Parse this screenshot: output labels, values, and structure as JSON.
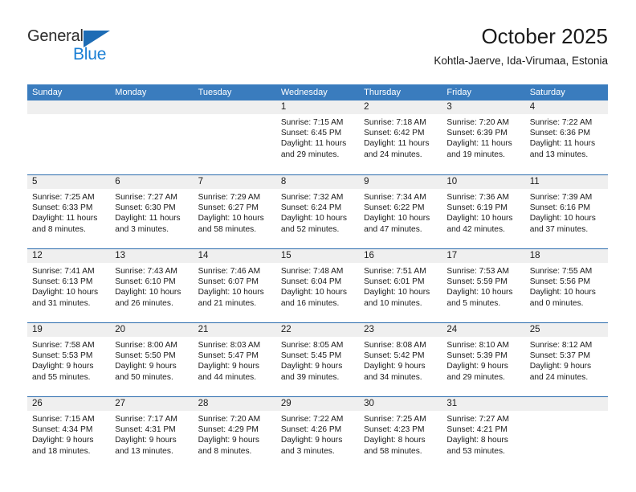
{
  "brand": {
    "name_part1": "General",
    "name_part2": "Blue",
    "triangle_icon": "triangle-logo-icon",
    "accent_color": "#1b7fd4",
    "triangle_color": "#1d6cb5"
  },
  "header": {
    "title": "October 2025",
    "subtitle": "Kohtla-Jaerve, Ida-Virumaa, Estonia"
  },
  "calendar": {
    "header_bg": "#3a7cbe",
    "row_divider_color": "#2b6cad",
    "daynum_bg": "#efefef",
    "weekdays": [
      "Sunday",
      "Monday",
      "Tuesday",
      "Wednesday",
      "Thursday",
      "Friday",
      "Saturday"
    ],
    "weeks": [
      [
        {
          "day": "",
          "empty": true,
          "sunrise": "",
          "sunset": "",
          "daylight1": "",
          "daylight2": ""
        },
        {
          "day": "",
          "empty": true,
          "sunrise": "",
          "sunset": "",
          "daylight1": "",
          "daylight2": ""
        },
        {
          "day": "",
          "empty": true,
          "sunrise": "",
          "sunset": "",
          "daylight1": "",
          "daylight2": ""
        },
        {
          "day": "1",
          "empty": false,
          "sunrise": "Sunrise: 7:15 AM",
          "sunset": "Sunset: 6:45 PM",
          "daylight1": "Daylight: 11 hours",
          "daylight2": "and 29 minutes."
        },
        {
          "day": "2",
          "empty": false,
          "sunrise": "Sunrise: 7:18 AM",
          "sunset": "Sunset: 6:42 PM",
          "daylight1": "Daylight: 11 hours",
          "daylight2": "and 24 minutes."
        },
        {
          "day": "3",
          "empty": false,
          "sunrise": "Sunrise: 7:20 AM",
          "sunset": "Sunset: 6:39 PM",
          "daylight1": "Daylight: 11 hours",
          "daylight2": "and 19 minutes."
        },
        {
          "day": "4",
          "empty": false,
          "sunrise": "Sunrise: 7:22 AM",
          "sunset": "Sunset: 6:36 PM",
          "daylight1": "Daylight: 11 hours",
          "daylight2": "and 13 minutes."
        }
      ],
      [
        {
          "day": "5",
          "empty": false,
          "sunrise": "Sunrise: 7:25 AM",
          "sunset": "Sunset: 6:33 PM",
          "daylight1": "Daylight: 11 hours",
          "daylight2": "and 8 minutes."
        },
        {
          "day": "6",
          "empty": false,
          "sunrise": "Sunrise: 7:27 AM",
          "sunset": "Sunset: 6:30 PM",
          "daylight1": "Daylight: 11 hours",
          "daylight2": "and 3 minutes."
        },
        {
          "day": "7",
          "empty": false,
          "sunrise": "Sunrise: 7:29 AM",
          "sunset": "Sunset: 6:27 PM",
          "daylight1": "Daylight: 10 hours",
          "daylight2": "and 58 minutes."
        },
        {
          "day": "8",
          "empty": false,
          "sunrise": "Sunrise: 7:32 AM",
          "sunset": "Sunset: 6:24 PM",
          "daylight1": "Daylight: 10 hours",
          "daylight2": "and 52 minutes."
        },
        {
          "day": "9",
          "empty": false,
          "sunrise": "Sunrise: 7:34 AM",
          "sunset": "Sunset: 6:22 PM",
          "daylight1": "Daylight: 10 hours",
          "daylight2": "and 47 minutes."
        },
        {
          "day": "10",
          "empty": false,
          "sunrise": "Sunrise: 7:36 AM",
          "sunset": "Sunset: 6:19 PM",
          "daylight1": "Daylight: 10 hours",
          "daylight2": "and 42 minutes."
        },
        {
          "day": "11",
          "empty": false,
          "sunrise": "Sunrise: 7:39 AM",
          "sunset": "Sunset: 6:16 PM",
          "daylight1": "Daylight: 10 hours",
          "daylight2": "and 37 minutes."
        }
      ],
      [
        {
          "day": "12",
          "empty": false,
          "sunrise": "Sunrise: 7:41 AM",
          "sunset": "Sunset: 6:13 PM",
          "daylight1": "Daylight: 10 hours",
          "daylight2": "and 31 minutes."
        },
        {
          "day": "13",
          "empty": false,
          "sunrise": "Sunrise: 7:43 AM",
          "sunset": "Sunset: 6:10 PM",
          "daylight1": "Daylight: 10 hours",
          "daylight2": "and 26 minutes."
        },
        {
          "day": "14",
          "empty": false,
          "sunrise": "Sunrise: 7:46 AM",
          "sunset": "Sunset: 6:07 PM",
          "daylight1": "Daylight: 10 hours",
          "daylight2": "and 21 minutes."
        },
        {
          "day": "15",
          "empty": false,
          "sunrise": "Sunrise: 7:48 AM",
          "sunset": "Sunset: 6:04 PM",
          "daylight1": "Daylight: 10 hours",
          "daylight2": "and 16 minutes."
        },
        {
          "day": "16",
          "empty": false,
          "sunrise": "Sunrise: 7:51 AM",
          "sunset": "Sunset: 6:01 PM",
          "daylight1": "Daylight: 10 hours",
          "daylight2": "and 10 minutes."
        },
        {
          "day": "17",
          "empty": false,
          "sunrise": "Sunrise: 7:53 AM",
          "sunset": "Sunset: 5:59 PM",
          "daylight1": "Daylight: 10 hours",
          "daylight2": "and 5 minutes."
        },
        {
          "day": "18",
          "empty": false,
          "sunrise": "Sunrise: 7:55 AM",
          "sunset": "Sunset: 5:56 PM",
          "daylight1": "Daylight: 10 hours",
          "daylight2": "and 0 minutes."
        }
      ],
      [
        {
          "day": "19",
          "empty": false,
          "sunrise": "Sunrise: 7:58 AM",
          "sunset": "Sunset: 5:53 PM",
          "daylight1": "Daylight: 9 hours",
          "daylight2": "and 55 minutes."
        },
        {
          "day": "20",
          "empty": false,
          "sunrise": "Sunrise: 8:00 AM",
          "sunset": "Sunset: 5:50 PM",
          "daylight1": "Daylight: 9 hours",
          "daylight2": "and 50 minutes."
        },
        {
          "day": "21",
          "empty": false,
          "sunrise": "Sunrise: 8:03 AM",
          "sunset": "Sunset: 5:47 PM",
          "daylight1": "Daylight: 9 hours",
          "daylight2": "and 44 minutes."
        },
        {
          "day": "22",
          "empty": false,
          "sunrise": "Sunrise: 8:05 AM",
          "sunset": "Sunset: 5:45 PM",
          "daylight1": "Daylight: 9 hours",
          "daylight2": "and 39 minutes."
        },
        {
          "day": "23",
          "empty": false,
          "sunrise": "Sunrise: 8:08 AM",
          "sunset": "Sunset: 5:42 PM",
          "daylight1": "Daylight: 9 hours",
          "daylight2": "and 34 minutes."
        },
        {
          "day": "24",
          "empty": false,
          "sunrise": "Sunrise: 8:10 AM",
          "sunset": "Sunset: 5:39 PM",
          "daylight1": "Daylight: 9 hours",
          "daylight2": "and 29 minutes."
        },
        {
          "day": "25",
          "empty": false,
          "sunrise": "Sunrise: 8:12 AM",
          "sunset": "Sunset: 5:37 PM",
          "daylight1": "Daylight: 9 hours",
          "daylight2": "and 24 minutes."
        }
      ],
      [
        {
          "day": "26",
          "empty": false,
          "sunrise": "Sunrise: 7:15 AM",
          "sunset": "Sunset: 4:34 PM",
          "daylight1": "Daylight: 9 hours",
          "daylight2": "and 18 minutes."
        },
        {
          "day": "27",
          "empty": false,
          "sunrise": "Sunrise: 7:17 AM",
          "sunset": "Sunset: 4:31 PM",
          "daylight1": "Daylight: 9 hours",
          "daylight2": "and 13 minutes."
        },
        {
          "day": "28",
          "empty": false,
          "sunrise": "Sunrise: 7:20 AM",
          "sunset": "Sunset: 4:29 PM",
          "daylight1": "Daylight: 9 hours",
          "daylight2": "and 8 minutes."
        },
        {
          "day": "29",
          "empty": false,
          "sunrise": "Sunrise: 7:22 AM",
          "sunset": "Sunset: 4:26 PM",
          "daylight1": "Daylight: 9 hours",
          "daylight2": "and 3 minutes."
        },
        {
          "day": "30",
          "empty": false,
          "sunrise": "Sunrise: 7:25 AM",
          "sunset": "Sunset: 4:23 PM",
          "daylight1": "Daylight: 8 hours",
          "daylight2": "and 58 minutes."
        },
        {
          "day": "31",
          "empty": false,
          "sunrise": "Sunrise: 7:27 AM",
          "sunset": "Sunset: 4:21 PM",
          "daylight1": "Daylight: 8 hours",
          "daylight2": "and 53 minutes."
        },
        {
          "day": "",
          "empty": true,
          "sunrise": "",
          "sunset": "",
          "daylight1": "",
          "daylight2": ""
        }
      ]
    ]
  }
}
